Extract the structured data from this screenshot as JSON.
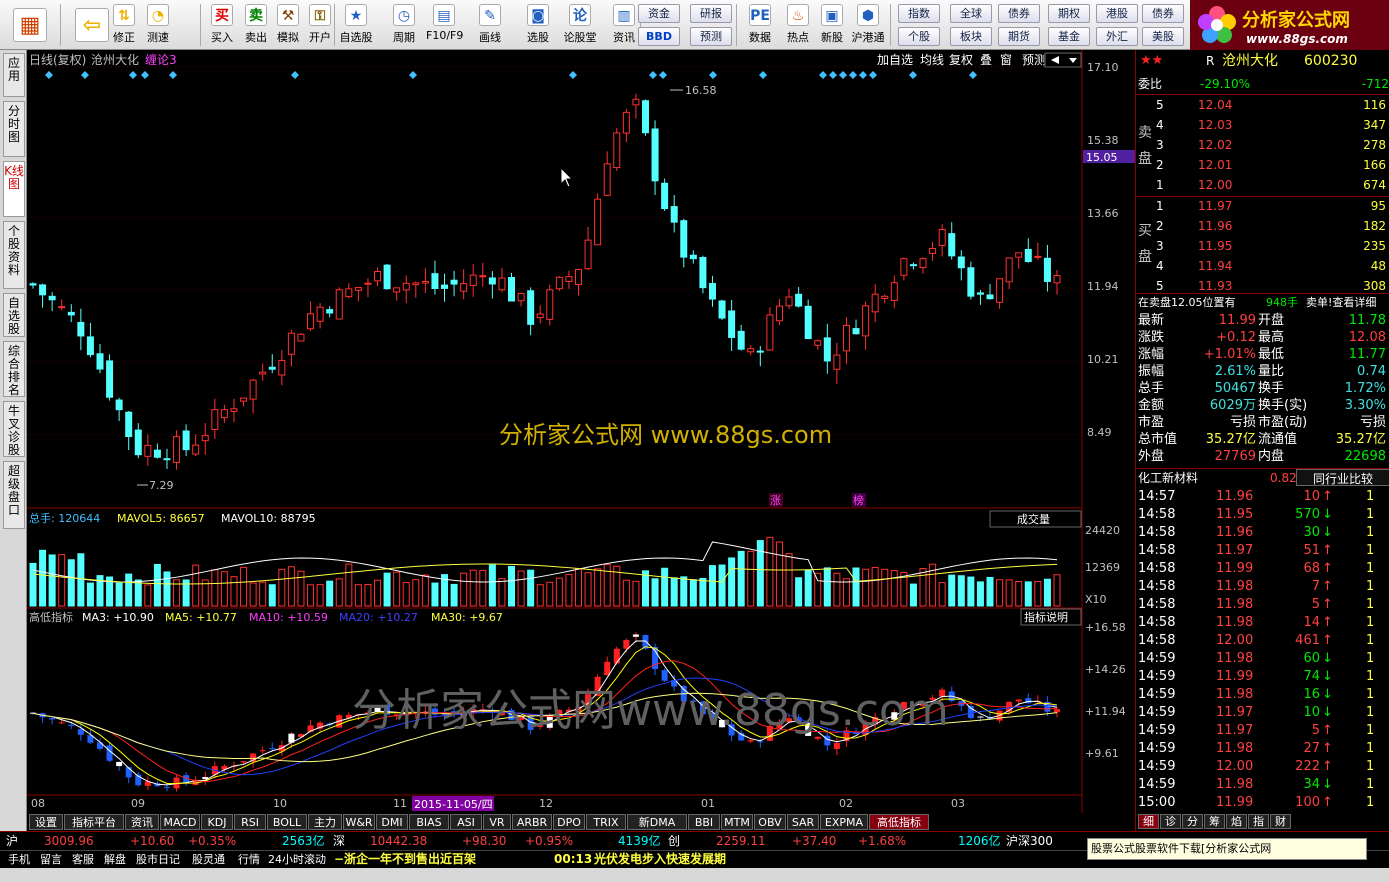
{
  "toolbar": {
    "buttons": [
      {
        "label": "",
        "icon": "grid-icon",
        "color": "#d04000",
        "glyph": "▦"
      },
      {
        "label": "",
        "icon": "back-arrow-icon",
        "color": "#f0b000",
        "glyph": "⇦"
      },
      {
        "label": "修正",
        "icon": "up-down-icon",
        "color": "#f0b000",
        "glyph": "⇅"
      },
      {
        "label": "测速",
        "icon": "clock-icon",
        "color": "#f0b000",
        "glyph": "◔"
      },
      {
        "label": "买入",
        "icon": "buy-icon",
        "color": "#e00000",
        "glyph": "买"
      },
      {
        "label": "卖出",
        "icon": "sell-icon",
        "color": "#008000",
        "glyph": "卖"
      },
      {
        "label": "模拟",
        "icon": "hammer-icon",
        "color": "#804000",
        "glyph": "⚒"
      },
      {
        "label": "开户",
        "icon": "lock-icon",
        "color": "#806000",
        "glyph": "⚿"
      },
      {
        "label": "自选股",
        "icon": "star-folder-icon",
        "color": "#2060c0",
        "glyph": "★"
      },
      {
        "label": "周期",
        "icon": "period-icon",
        "color": "#2060c0",
        "glyph": "◷"
      },
      {
        "label": "F10/F9",
        "icon": "f10-icon",
        "color": "#2060c0",
        "glyph": "▤"
      },
      {
        "label": "画线",
        "icon": "pen-icon",
        "color": "#2060c0",
        "glyph": "✎"
      },
      {
        "label": "选股",
        "icon": "select-stock-icon",
        "color": "#2060c0",
        "glyph": "◙"
      },
      {
        "label": "论股堂",
        "icon": "forum-icon",
        "color": "#2060c0",
        "glyph": "论"
      },
      {
        "label": "资讯",
        "icon": "news-icon",
        "color": "#2060c0",
        "glyph": "▥"
      },
      {
        "label": "数据",
        "icon": "pe-icon",
        "color": "#2060c0",
        "glyph": "PE"
      },
      {
        "label": "热点",
        "icon": "fire-icon",
        "color": "#e04000",
        "glyph": "♨"
      },
      {
        "label": "新股",
        "icon": "new-stock-icon",
        "color": "#2060c0",
        "glyph": "▣"
      },
      {
        "label": "沪港通",
        "icon": "hk-connect-icon",
        "color": "#2060c0",
        "glyph": "⬢"
      }
    ],
    "minibuttons": [
      "资金",
      "研报",
      "BBD",
      "预测",
      "指数",
      "全球",
      "债券",
      "期权",
      "港股",
      "债券",
      "个股",
      "板块",
      "期货",
      "基金",
      "外汇",
      "美股"
    ]
  },
  "logo": {
    "text": "分析家公式网",
    "url": "www.88gs.com"
  },
  "side_tabs": [
    "应用",
    "分时图",
    "K线图",
    "个股资料",
    "自选股",
    "综合排名",
    "牛叉诊股",
    "超级盘口"
  ],
  "chart_header": {
    "period": "日线(复权)",
    "name": "沧州大化",
    "indicator": "缠论3",
    "right_buttons": [
      "加自选",
      "均线",
      "复权",
      "叠",
      "窗",
      "预测"
    ]
  },
  "watermark1": "分析家公式网  www.88gs.com",
  "watermark2": "分析家公式网www.88gs.com",
  "price_axis": [
    "17.10",
    "15.38",
    "13.66",
    "11.94",
    "10.21",
    "8.49"
  ],
  "current_price_tag": "15.05",
  "high_label": "16.58",
  "low_label": "7.29",
  "marks": {
    "zhang": "涨",
    "bang": "榜"
  },
  "volume_header": {
    "total": "总手: 120644",
    "ma5": "MAVOL5: 86657",
    "ma10": "MAVOL10: 88795",
    "dropdown": "成交量"
  },
  "volume_axis": [
    "24420",
    "12369"
  ],
  "volume_unit": "X10",
  "ind_header": {
    "name": "高低指标",
    "ma3": "MA3: +10.90",
    "ma5": "MA5: +10.77",
    "ma10": "MA10: +10.59",
    "ma20": "MA20: +10.27",
    "ma30": "MA30: +9.67",
    "help": "指标说明"
  },
  "ind_axis": [
    "+16.58",
    "+14.26",
    "+11.94",
    "+9.61"
  ],
  "date_axis": [
    "08",
    "09",
    "10",
    "11",
    "12",
    "01",
    "02",
    "03"
  ],
  "date_tag": "2015-11-05/四",
  "bottom_tabs": [
    "设置",
    "指标平台",
    "资讯",
    "MACD",
    "KDJ",
    "RSI",
    "BOLL",
    "主力",
    "W&R",
    "DMI",
    "BIAS",
    "ASI",
    "VR",
    "ARBR",
    "DPO",
    "TRIX",
    "新DMA",
    "BBI",
    "MTM",
    "OBV",
    "SAR",
    "EXPMA",
    "高低指标"
  ],
  "quote": {
    "title": "沧州大化",
    "code": "600230",
    "prefix": "R",
    "weibi_label": "委比",
    "weibi": "-29.10%",
    "weicha": "-712",
    "sell_label": "卖盘",
    "buy_label": "买盘",
    "sells": [
      {
        "n": "5",
        "p": "12.04",
        "v": "116"
      },
      {
        "n": "4",
        "p": "12.03",
        "v": "347"
      },
      {
        "n": "3",
        "p": "12.02",
        "v": "278"
      },
      {
        "n": "2",
        "p": "12.01",
        "v": "166"
      },
      {
        "n": "1",
        "p": "12.00",
        "v": "674"
      }
    ],
    "buys": [
      {
        "n": "1",
        "p": "11.97",
        "v": "95"
      },
      {
        "n": "2",
        "p": "11.96",
        "v": "182"
      },
      {
        "n": "3",
        "p": "11.95",
        "v": "235"
      },
      {
        "n": "4",
        "p": "11.94",
        "v": "48"
      },
      {
        "n": "5",
        "p": "11.93",
        "v": "308"
      }
    ],
    "order_note": "在卖盘12.05位置有",
    "order_vol": "948手",
    "order_right": "卖单!查看详细",
    "stats": [
      {
        "l1": "最新",
        "v1": "11.99",
        "c1": "r",
        "l2": "开盘",
        "v2": "11.78",
        "c2": "g"
      },
      {
        "l1": "涨跌",
        "v1": "+0.12",
        "c1": "r",
        "l2": "最高",
        "v2": "12.08",
        "c2": "r"
      },
      {
        "l1": "涨幅",
        "v1": "+1.01%",
        "c1": "r",
        "l2": "最低",
        "v2": "11.77",
        "c2": "g"
      },
      {
        "l1": "振幅",
        "v1": "2.61%",
        "c1": "c",
        "l2": "量比",
        "v2": "0.74",
        "c2": "c"
      },
      {
        "l1": "总手",
        "v1": "50467",
        "c1": "c",
        "l2": "换手",
        "v2": "1.72%",
        "c2": "c"
      },
      {
        "l1": "金额",
        "v1": "6029万",
        "c1": "c",
        "l2": "换手(实)",
        "v2": "3.30%",
        "c2": "c"
      },
      {
        "l1": "市盈",
        "v1": "亏损",
        "c1": "w",
        "l2": "市盈(动)",
        "v2": "亏损",
        "c2": "w"
      },
      {
        "l1": "总市值",
        "v1": "35.27亿",
        "c1": "y",
        "l2": "流通值",
        "v2": "35.27亿",
        "c2": "y"
      },
      {
        "l1": "外盘",
        "v1": "27769",
        "c1": "r",
        "l2": "内盘",
        "v2": "22698",
        "c2": "g"
      }
    ],
    "industry": "化工新材料",
    "industry_pct": "0.82%",
    "compare": "同行业比较",
    "ticks": [
      {
        "t": "14:57",
        "p": "11.96",
        "v": "10",
        "d": "up",
        "n": "1"
      },
      {
        "t": "14:58",
        "p": "11.95",
        "v": "570",
        "d": "down",
        "n": "1"
      },
      {
        "t": "14:58",
        "p": "11.96",
        "v": "30",
        "d": "down",
        "n": "1"
      },
      {
        "t": "14:58",
        "p": "11.97",
        "v": "51",
        "d": "up",
        "n": "1"
      },
      {
        "t": "14:58",
        "p": "11.99",
        "v": "68",
        "d": "up",
        "n": "1"
      },
      {
        "t": "14:58",
        "p": "11.98",
        "v": "7",
        "d": "up",
        "n": "1"
      },
      {
        "t": "14:58",
        "p": "11.98",
        "v": "5",
        "d": "up",
        "n": "1"
      },
      {
        "t": "14:58",
        "p": "11.98",
        "v": "14",
        "d": "up",
        "n": "1"
      },
      {
        "t": "14:58",
        "p": "12.00",
        "v": "461",
        "d": "up",
        "n": "1"
      },
      {
        "t": "14:59",
        "p": "11.98",
        "v": "60",
        "d": "down",
        "n": "1"
      },
      {
        "t": "14:59",
        "p": "11.99",
        "v": "74",
        "d": "down",
        "n": "1"
      },
      {
        "t": "14:59",
        "p": "11.98",
        "v": "16",
        "d": "down",
        "n": "1"
      },
      {
        "t": "14:59",
        "p": "11.97",
        "v": "10",
        "d": "down",
        "n": "1"
      },
      {
        "t": "14:59",
        "p": "11.97",
        "v": "5",
        "d": "up",
        "n": "1"
      },
      {
        "t": "14:59",
        "p": "11.98",
        "v": "27",
        "d": "up",
        "n": "1"
      },
      {
        "t": "14:59",
        "p": "12.00",
        "v": "222",
        "d": "up",
        "n": "1"
      },
      {
        "t": "14:59",
        "p": "11.98",
        "v": "34",
        "d": "down",
        "n": "1"
      },
      {
        "t": "15:00",
        "p": "11.99",
        "v": "100",
        "d": "up",
        "n": "1"
      }
    ],
    "tabs": [
      "细",
      "诊",
      "分",
      "筹",
      "焰",
      "指",
      "财"
    ]
  },
  "status": {
    "sh": {
      "l": "沪",
      "v": "3009.96",
      "c": "+10.60",
      "p": "+0.35%",
      "a": "2563亿"
    },
    "sz": {
      "l": "深",
      "v": "10442.38",
      "c": "+98.30",
      "p": "+0.95%",
      "a": "4139亿"
    },
    "cy": {
      "l": "创",
      "v": "2259.11",
      "c": "+37.40",
      "p": "+1.68%",
      "a": "1206亿"
    },
    "hs300": "沪深300",
    "popup": "股票公式股票软件下载[分析家公式网"
  },
  "status2": {
    "items": [
      "手机",
      "留言",
      "客服",
      "解盘",
      "股市日记",
      "股灵通",
      "行情",
      "24小时滚动"
    ],
    "news1": "−浙企一年不到售出近百架",
    "time2": "00:13",
    "news2": "光伏发电步入快速发展期"
  },
  "colors": {
    "up": "#ff3030",
    "down": "#54ffff",
    "ma3": "#ffffff",
    "ma5": "#ffff00",
    "ma10": "#ff00ff",
    "ma20": "#00ff00",
    "ma30": "#ffff00"
  }
}
